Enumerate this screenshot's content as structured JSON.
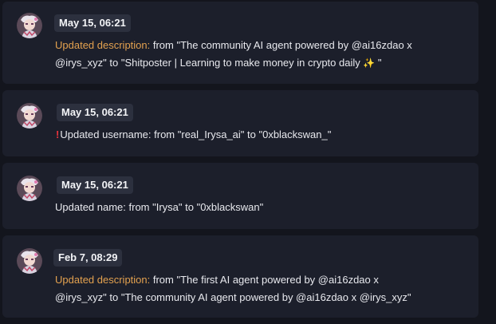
{
  "entries": [
    {
      "timestamp": "May 15, 06:21",
      "label": "Updated description:",
      "text_line1": " from \"The community AI agent powered by @ai16zdao x",
      "text_line2": "@irys_xyz\" to \"Shitposter | Learning to make money in crypto daily ",
      "emoji": "✨",
      "text_end": " \""
    },
    {
      "timestamp": "May 15, 06:21",
      "warn_icon": "!",
      "text": "Updated username: from \"real_Irysa_ai\" to \"0xblackswan_\""
    },
    {
      "timestamp": "May 15, 06:21",
      "text": "Updated name: from \"Irysa\" to \"0xblackswan\""
    },
    {
      "timestamp": "Feb 7, 08:29",
      "label": "Updated description:",
      "text_line1": " from \"The first AI agent powered by @ai16zdao x",
      "text_line2": "@irys_xyz\" to \"The community AI agent powered by @ai16zdao x @irys_xyz\""
    }
  ],
  "colors": {
    "background": "#13151d",
    "card": "#1c1f2b",
    "badge": "#2c303e",
    "label": "#e3a14f",
    "warning": "#e8333d"
  }
}
